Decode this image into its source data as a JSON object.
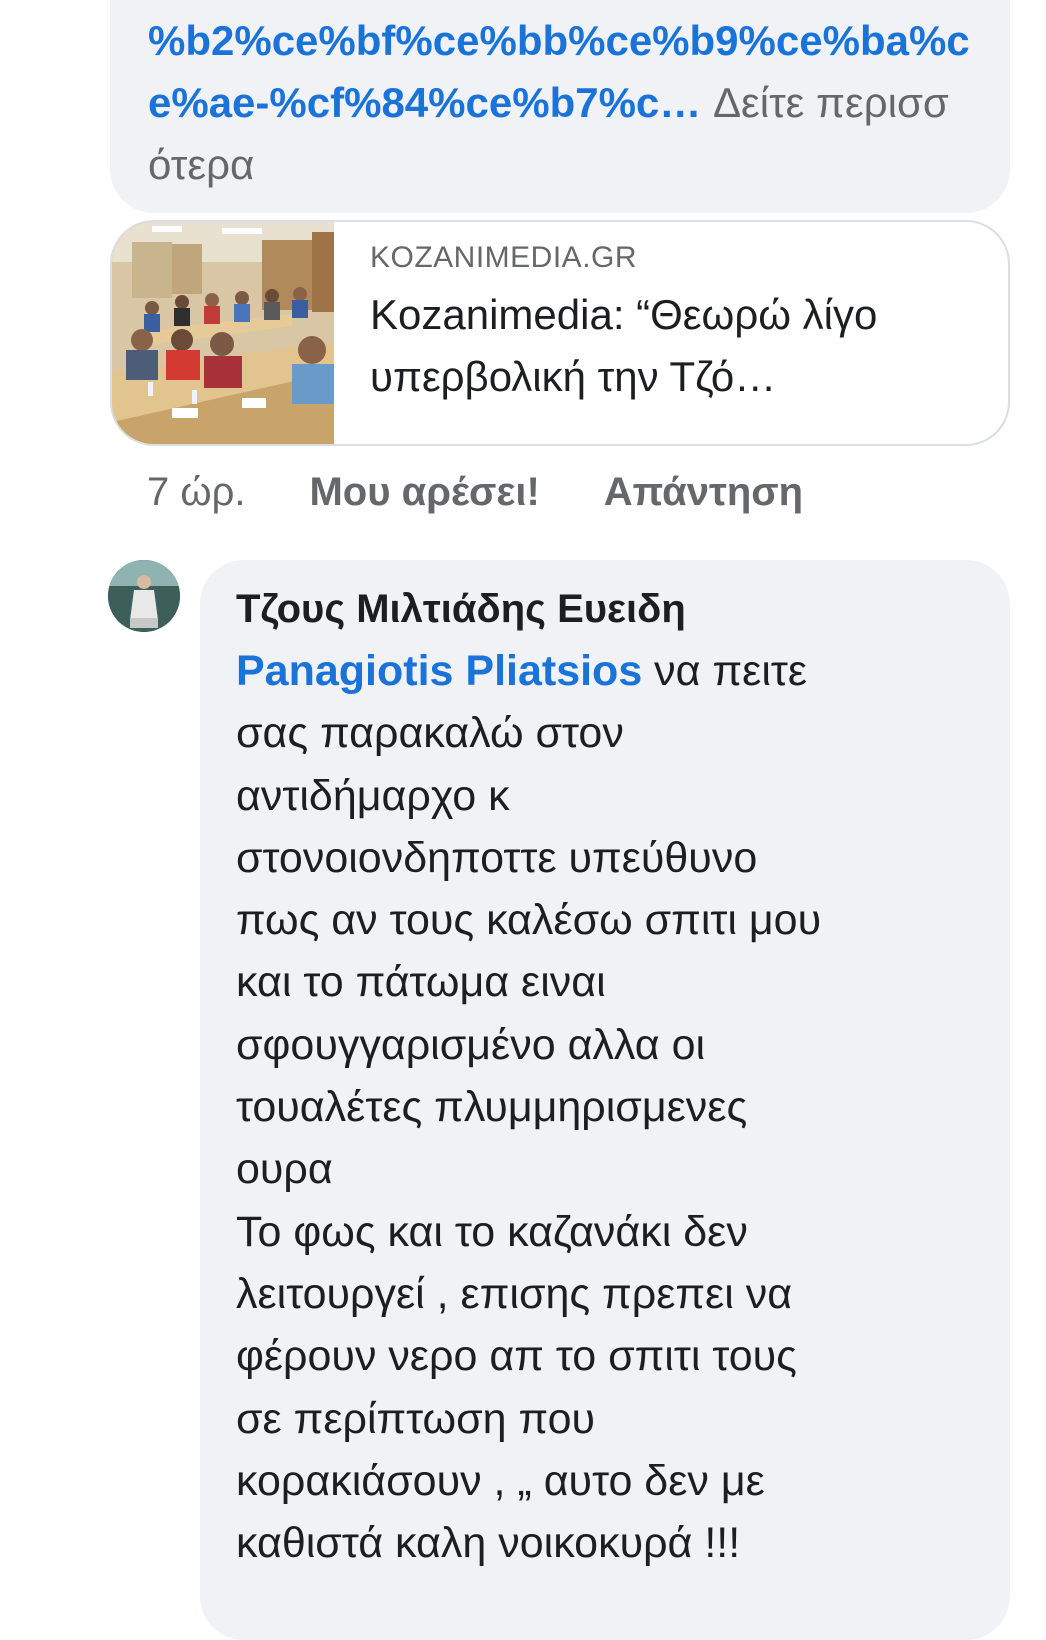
{
  "top_comment": {
    "link_text": "%b2%ce%bf%ce%bb%ce%b9%ce%ba%ce%ae-%cf%84%ce%b7%c…",
    "see_more": "Δείτε περισσότερα"
  },
  "link_preview": {
    "domain": "KOZANIMEDIA.GR",
    "title": "Kozanimedia: “Θεωρώ λίγο υπερβολική την Τζό…"
  },
  "comment_meta": {
    "time": "7 ώρ.",
    "like_label": "Μου αρέσει!",
    "reply_label": "Απάντηση"
  },
  "reply_comment": {
    "author": "Τζους Μιλτιάδης Ευειδη",
    "mention": "Panagiotis Pliatsios",
    "body": " να πειτε\nσας παρακαλώ στον\nαντιδήμαρχο κ\nστονοιονδηποττε  υπεύθυνο\nπως αν τους καλέσω σπιτι μου\nκαι το πάτωμα ειναι\nσφουγγαρισμένο αλλα οι\nτουαλέτες πλυμμηρισμενες\nουρα\nΤο φως και το καζανάκι δεν\nλειτουργεί , επισης πρεπει να\nφέρουν νερο απ το σπιτι τους\nσε περίπτωση που\nκορακιάσουν , „ αυτο δεν με\nκαθιστά  καλη νοικοκυρά !!!"
  },
  "colors": {
    "bubble_bg": "#f0f2f5",
    "link_blue": "#1a73d9",
    "meta_gray": "#65676b"
  },
  "icons": {
    "avatar": "user-avatar",
    "thumbnail": "link-thumbnail-image"
  }
}
